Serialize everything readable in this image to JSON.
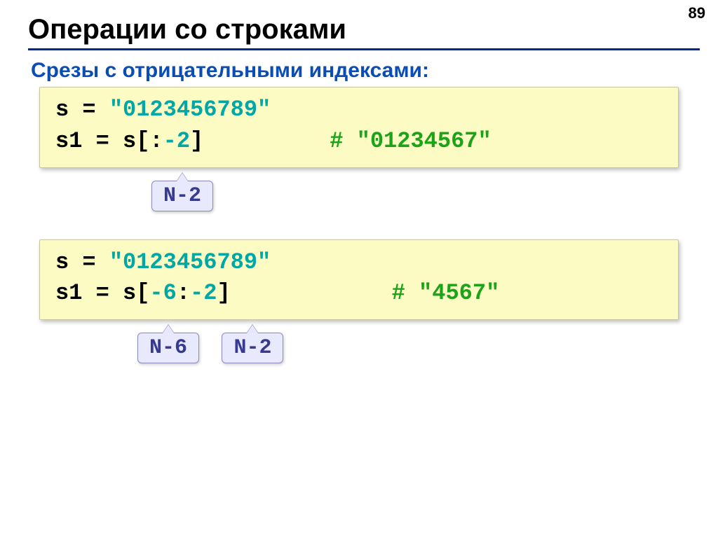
{
  "pagenum": "89",
  "title": "Операции со строками",
  "subtitle": "Срезы с отрицательными индексами:",
  "ex1": {
    "line1": {
      "lhs": "s = ",
      "str": "\"0123456789\""
    },
    "line2": {
      "lhs": "s1 = s[:",
      "neg": "-2",
      "rhs": "]",
      "comment": "# \"01234567\""
    },
    "tag": "N-2"
  },
  "ex2": {
    "line1": {
      "lhs": "s = ",
      "str": "\"0123456789\""
    },
    "line2": {
      "lhs": "s1 = s[",
      "neg1": "-6",
      "colon": ":",
      "neg2": "-2",
      "rhs": "]",
      "comment": "# \"4567\""
    },
    "tag1": "N-6",
    "tag2": "N-2"
  }
}
